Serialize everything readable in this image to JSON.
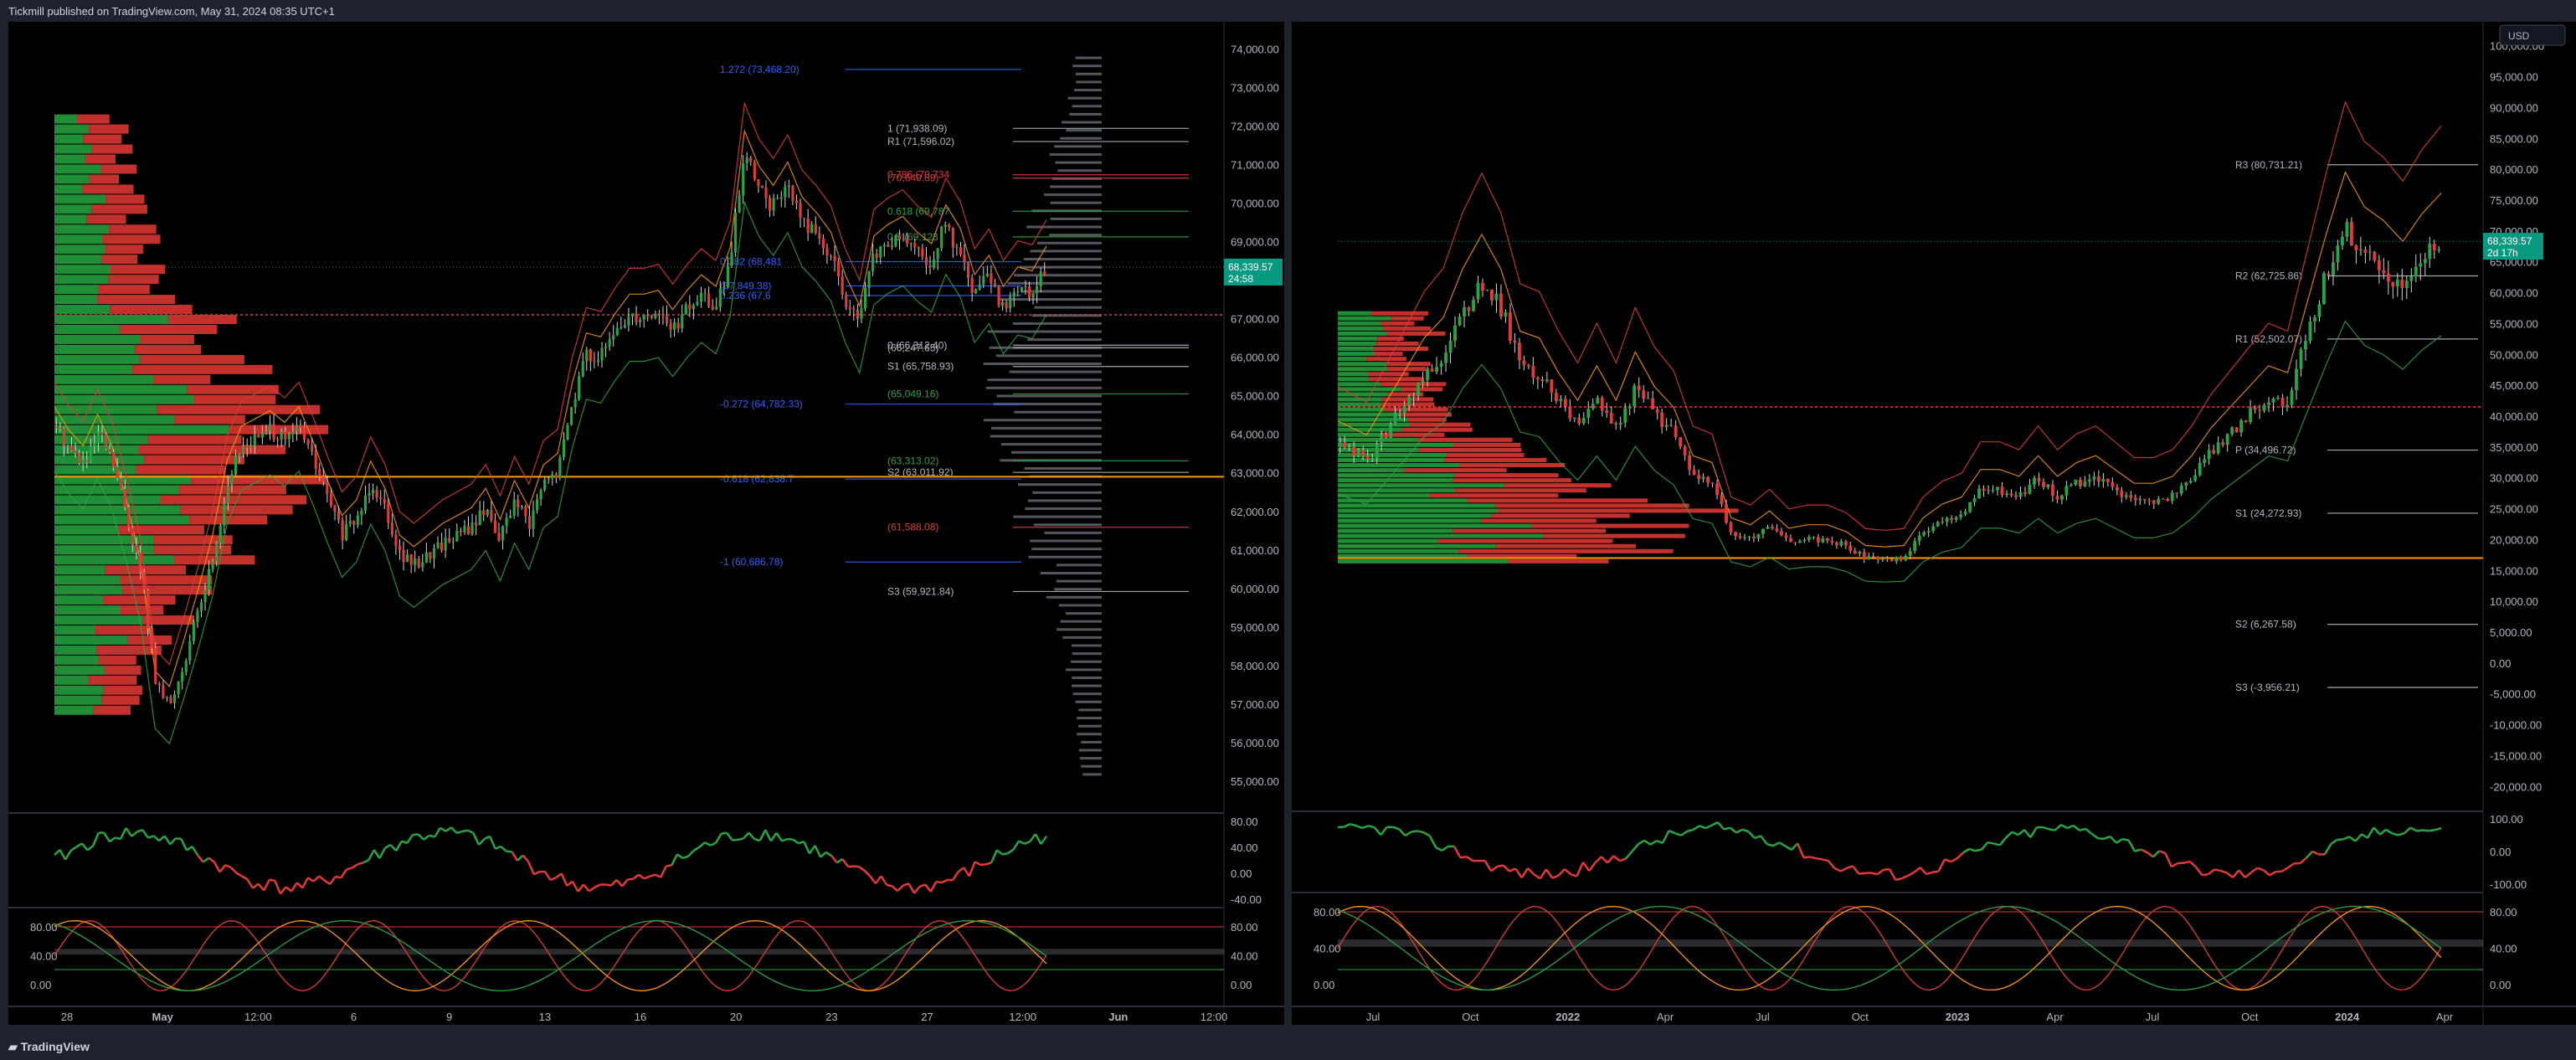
{
  "header": {
    "published": "Tickmill published on TradingView.com, May 31, 2024 08:35 UTC+1"
  },
  "footer": {
    "brand": "TradingView"
  },
  "colors": {
    "bg": "#000000",
    "frame": "#1e222d",
    "up": "#26a641",
    "down": "#e53935",
    "orange": "#ff9800",
    "grid": "#2a2e39",
    "axis_text": "#b2b5be",
    "fib_blue": "#2962ff",
    "price_green": "#089981"
  },
  "chart_data": [
    {
      "type": "candlestick",
      "panel": "left",
      "price_axis": {
        "ticks": [
          "74,000.00",
          "73,000.00",
          "72,000.00",
          "71,000.00",
          "70,000.00",
          "69,000.00",
          "68,000.00",
          "67,000.00",
          "66,000.00",
          "65,000.00",
          "64,000.00",
          "63,000.00",
          "62,000.00",
          "61,000.00",
          "60,000.00",
          "59,000.00",
          "58,000.00",
          "57,000.00",
          "56,000.00",
          "55,000.00"
        ],
        "range": [
          54500,
          74400
        ]
      },
      "time_axis": {
        "ticks": [
          "28",
          "May",
          "12:00",
          "6",
          "9",
          "13",
          "16",
          "20",
          "23",
          "27",
          "12:00",
          "Jun",
          "12:00"
        ]
      },
      "last_price": {
        "price": "68,339.57",
        "countdown": "24:58",
        "value": 68339.57
      },
      "close_path": [
        [
          0,
          64200
        ],
        [
          2,
          63600
        ],
        [
          4,
          63200
        ],
        [
          6,
          64000
        ],
        [
          8,
          63200
        ],
        [
          10,
          61800
        ],
        [
          12,
          60200
        ],
        [
          14,
          57400
        ],
        [
          16,
          57000
        ],
        [
          18,
          58200
        ],
        [
          20,
          59500
        ],
        [
          22,
          60900
        ],
        [
          24,
          62800
        ],
        [
          26,
          63700
        ],
        [
          28,
          63900
        ],
        [
          30,
          64100
        ],
        [
          32,
          63800
        ],
        [
          34,
          64200
        ],
        [
          36,
          63300
        ],
        [
          38,
          62300
        ],
        [
          40,
          61400
        ],
        [
          42,
          61800
        ],
        [
          44,
          62800
        ],
        [
          46,
          62100
        ],
        [
          48,
          60900
        ],
        [
          50,
          60600
        ],
        [
          52,
          60900
        ],
        [
          54,
          61200
        ],
        [
          56,
          61400
        ],
        [
          58,
          61600
        ],
        [
          60,
          62100
        ],
        [
          62,
          61300
        ],
        [
          64,
          62300
        ],
        [
          66,
          61600
        ],
        [
          68,
          62700
        ],
        [
          70,
          63000
        ],
        [
          72,
          64800
        ],
        [
          74,
          66100
        ],
        [
          76,
          66000
        ],
        [
          78,
          66600
        ],
        [
          80,
          67100
        ],
        [
          82,
          67100
        ],
        [
          84,
          67200
        ],
        [
          86,
          66700
        ],
        [
          88,
          67200
        ],
        [
          90,
          67600
        ],
        [
          92,
          67300
        ],
        [
          94,
          68300
        ],
        [
          96,
          71300
        ],
        [
          98,
          70400
        ],
        [
          100,
          69900
        ],
        [
          102,
          70500
        ],
        [
          104,
          69600
        ],
        [
          106,
          69200
        ],
        [
          108,
          68700
        ],
        [
          110,
          67600
        ],
        [
          112,
          66800
        ],
        [
          114,
          68600
        ],
        [
          116,
          68900
        ],
        [
          118,
          69100
        ],
        [
          120,
          68700
        ],
        [
          122,
          68400
        ],
        [
          124,
          69400
        ],
        [
          126,
          68800
        ],
        [
          128,
          67600
        ],
        [
          130,
          68100
        ],
        [
          132,
          67300
        ],
        [
          134,
          67800
        ],
        [
          136,
          67700
        ],
        [
          138,
          68339
        ]
      ],
      "volume_profile": {
        "side": "left",
        "rows": 60
      },
      "levels": [
        {
          "label": "1.272 (73,468.20)",
          "value": 73468.2,
          "color": "#2962ff"
        },
        {
          "label": "1 (71,938.09)",
          "value": 71938.09,
          "color": "#b2b5be"
        },
        {
          "label": "R1 (71,596.02)",
          "value": 71596.02,
          "color": "#b2b5be"
        },
        {
          "label": "0.786 (70,734",
          "value": 70734,
          "color": "#e53935"
        },
        {
          "label": "(70,649.69)",
          "value": 70649.69,
          "color": "#e53935"
        },
        {
          "label": "0.618 (69,787",
          "value": 69787,
          "color": "#26a641"
        },
        {
          "label": "0.5 (69,123",
          "value": 69123,
          "color": "#26a641"
        },
        {
          "label": "0.382 (68,481",
          "value": 68481,
          "color": "#2962ff"
        },
        {
          "label": "(67,849.38)",
          "value": 67849.38,
          "color": "#2962ff"
        },
        {
          "label": "0.236 (67,6",
          "value": 67600,
          "color": "#2962ff"
        },
        {
          "label": "0 (66,312.40)",
          "value": 66312.4,
          "color": "#b2b5be"
        },
        {
          "label": "(66,247.65)",
          "value": 66247.65,
          "color": "#b2b5be"
        },
        {
          "label": "S1 (65,758.93)",
          "value": 65758.93,
          "color": "#b2b5be"
        },
        {
          "label": "-0.272 (64,782.33)",
          "value": 64782.33,
          "color": "#2962ff"
        },
        {
          "label": "(65,049.16)",
          "value": 65049.16,
          "color": "#26a641"
        },
        {
          "label": "(63,313.02)",
          "value": 63313.02,
          "color": "#26a641"
        },
        {
          "label": "S2 (63,011.92)",
          "value": 63011.92,
          "color": "#b2b5be"
        },
        {
          "label": "-0.618 (62,838.7",
          "value": 62838.7,
          "color": "#2962ff"
        },
        {
          "label": "(61,588.08)",
          "value": 61588.08,
          "color": "#e53935"
        },
        {
          "label": "-1 (60,686.78)",
          "value": 60686.78,
          "color": "#2962ff"
        },
        {
          "label": "S3 (59,921.84)",
          "value": 59921.84,
          "color": "#b2b5be"
        }
      ],
      "rsi": {
        "ticks": [
          "80.00",
          "40.00",
          "0.00",
          "-40.00"
        ]
      },
      "stoch": {
        "ticks_left": [
          "80.00",
          "40.00",
          "0.00"
        ],
        "ticks_right": [
          "80.00",
          "40.00",
          "0.00"
        ]
      }
    },
    {
      "type": "candlestick",
      "panel": "right",
      "currency": "USD",
      "price_axis": {
        "ticks": [
          "100,000.00",
          "95,000.00",
          "90,000.00",
          "85,000.00",
          "80,000.00",
          "75,000.00",
          "70,000.00",
          "65,000.00",
          "60,000.00",
          "55,000.00",
          "50,000.00",
          "45,000.00",
          "40,000.00",
          "35,000.00",
          "30,000.00",
          "25,000.00",
          "20,000.00",
          "15,000.00",
          "10,000.00",
          "5,000.00",
          "0.00",
          "-5,000.00",
          "-10,000.00",
          "-15,000.00",
          "-20,000.00"
        ],
        "range": [
          -22000,
          102000
        ]
      },
      "time_axis": {
        "ticks": [
          "Jul",
          "Oct",
          "2022",
          "Apr",
          "Jul",
          "Oct",
          "2023",
          "Apr",
          "Jul",
          "Oct",
          "2024",
          "Apr"
        ]
      },
      "last_price": {
        "price": "68,339.57",
        "countdown": "2d 17h",
        "value": 68339.57
      },
      "close_path": [
        [
          0,
          35000
        ],
        [
          3,
          33000
        ],
        [
          6,
          40000
        ],
        [
          9,
          47000
        ],
        [
          11,
          50000
        ],
        [
          13,
          57000
        ],
        [
          15,
          62000
        ],
        [
          17,
          57000
        ],
        [
          19,
          48000
        ],
        [
          21,
          47000
        ],
        [
          23,
          42000
        ],
        [
          25,
          38000
        ],
        [
          27,
          43000
        ],
        [
          29,
          38000
        ],
        [
          31,
          45000
        ],
        [
          33,
          40000
        ],
        [
          35,
          37000
        ],
        [
          37,
          30000
        ],
        [
          39,
          29000
        ],
        [
          41,
          21000
        ],
        [
          43,
          20000
        ],
        [
          45,
          22000
        ],
        [
          47,
          19500
        ],
        [
          49,
          20000
        ],
        [
          51,
          20000
        ],
        [
          53,
          19000
        ],
        [
          55,
          17000
        ],
        [
          57,
          16800
        ],
        [
          59,
          17000
        ],
        [
          61,
          21000
        ],
        [
          63,
          23000
        ],
        [
          65,
          24000
        ],
        [
          67,
          28000
        ],
        [
          69,
          28000
        ],
        [
          71,
          27000
        ],
        [
          73,
          30000
        ],
        [
          75,
          27000
        ],
        [
          77,
          29000
        ],
        [
          79,
          30000
        ],
        [
          81,
          28000
        ],
        [
          83,
          26000
        ],
        [
          85,
          26000
        ],
        [
          87,
          27000
        ],
        [
          89,
          30000
        ],
        [
          91,
          34000
        ],
        [
          93,
          37000
        ],
        [
          95,
          40000
        ],
        [
          97,
          43000
        ],
        [
          99,
          42000
        ],
        [
          101,
          52000
        ],
        [
          103,
          62000
        ],
        [
          105,
          71000
        ],
        [
          107,
          66000
        ],
        [
          109,
          64000
        ],
        [
          111,
          61000
        ],
        [
          113,
          65000
        ],
        [
          115,
          68000
        ]
      ],
      "volume_profile": {
        "side": "left",
        "rows": 50
      },
      "levels": [
        {
          "label": "R3 (80,731.21)",
          "value": 80731.21,
          "color": "#b2b5be"
        },
        {
          "label": "R2 (62,725.86)",
          "value": 62725.86,
          "color": "#b2b5be"
        },
        {
          "label": "R1 (52,502.07)",
          "value": 52502.07,
          "color": "#b2b5be"
        },
        {
          "label": "P (34,496.72)",
          "value": 34496.72,
          "color": "#b2b5be"
        },
        {
          "label": "S1 (24,272.93)",
          "value": 24272.93,
          "color": "#b2b5be"
        },
        {
          "label": "S2 (6,267.58)",
          "value": 6267.58,
          "color": "#b2b5be"
        },
        {
          "label": "S3 (-3,956.21)",
          "value": -3956.21,
          "color": "#b2b5be"
        }
      ],
      "rsi": {
        "ticks": [
          "100.00",
          "0.00",
          "-100.00"
        ]
      },
      "stoch": {
        "ticks_left": [
          "80.00",
          "40.00",
          "0.00"
        ],
        "ticks_right": [
          "80.00",
          "40.00",
          "0.00"
        ]
      }
    }
  ]
}
